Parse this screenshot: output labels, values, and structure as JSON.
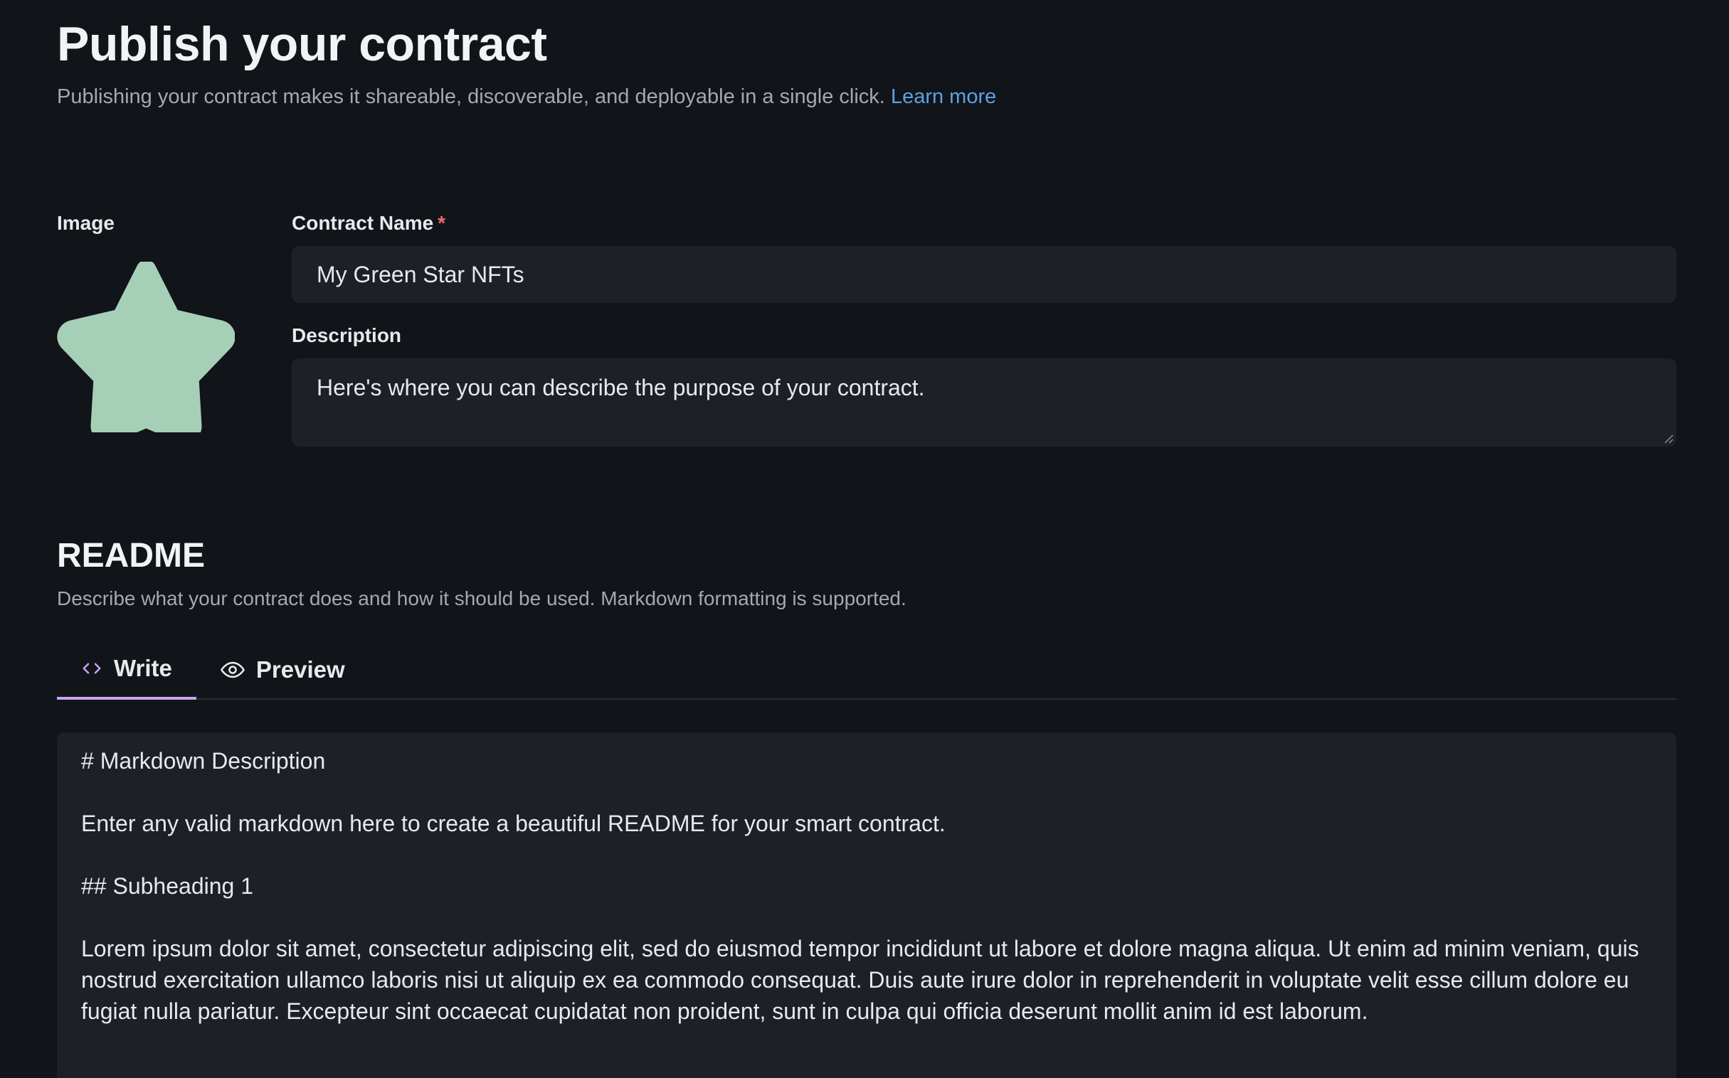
{
  "header": {
    "title": "Publish your contract",
    "subtitle": "Publishing your contract makes it shareable, discoverable, and deployable in a single click.",
    "learn_more": "Learn more"
  },
  "form": {
    "image_label": "Image",
    "image_icon": "star-icon",
    "image_color": "#a6cfb7",
    "contract_name_label": "Contract Name",
    "required_marker": "*",
    "contract_name_value": "My Green Star NFTs",
    "description_label": "Description",
    "description_value": "Here's where you can describe the purpose of your contract."
  },
  "readme": {
    "title": "README",
    "description": "Describe what your contract does and how it should be used. Markdown formatting is supported.",
    "tabs": [
      {
        "label": "Write",
        "icon": "code-icon",
        "active": true
      },
      {
        "label": "Preview",
        "icon": "eye-icon",
        "active": false
      }
    ],
    "content": {
      "line1": "# Markdown Description",
      "line2": "Enter any valid markdown here to create a beautiful README for your smart contract.",
      "line3": "## Subheading 1",
      "line4": "Lorem ipsum dolor sit amet, consectetur adipiscing elit, sed do eiusmod tempor incididunt ut labore et dolore magna aliqua. Ut enim ad minim veniam, quis nostrud exercitation ullamco laboris nisi ut aliquip ex ea commodo consequat. Duis aute irure dolor in reprehenderit in voluptate velit esse cillum dolore eu fugiat nulla pariatur. Excepteur sint occaecat cupidatat non proident, sunt in culpa qui officia deserunt mollit anim id est laborum."
    }
  },
  "colors": {
    "background": "#111419",
    "input_background": "#1d2026",
    "link": "#5aa2e4",
    "tab_active_underline": "#c7a4f2",
    "required": "#ef6b6b"
  }
}
